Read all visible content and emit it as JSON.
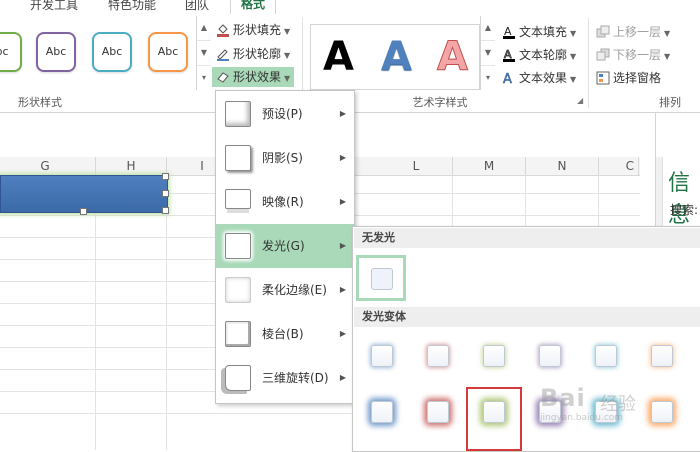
{
  "tabs": [
    {
      "label": "开发工具"
    },
    {
      "label": "特色功能"
    },
    {
      "label": "团队"
    },
    {
      "label": "格式"
    }
  ],
  "ribbon": {
    "shape_styles": {
      "label": "形状样式",
      "swatches": [
        {
          "text": "bc",
          "color": "#70ad47"
        },
        {
          "text": "Abc",
          "color": "#8064a2"
        },
        {
          "text": "Abc",
          "color": "#4bacc6"
        },
        {
          "text": "Abc",
          "color": "#f79646"
        }
      ],
      "commands": [
        {
          "label": "形状填充",
          "icon": "paint-bucket-icon"
        },
        {
          "label": "形状轮廓",
          "icon": "pen-outline-icon"
        },
        {
          "label": "形状效果",
          "icon": "shape-effects-icon"
        }
      ]
    },
    "wordart": {
      "label": "艺术字样式",
      "letters": [
        {
          "text": "A",
          "color": "#000000"
        },
        {
          "text": "A",
          "color": "#4f81bd"
        },
        {
          "text": "A",
          "color": "#e06666"
        }
      ],
      "commands": [
        {
          "label": "文本填充",
          "icon": "text-fill-icon"
        },
        {
          "label": "文本轮廓",
          "icon": "text-outline-icon"
        },
        {
          "label": "文本效果",
          "icon": "text-effects-icon"
        }
      ]
    },
    "arrange": {
      "label": "排列",
      "commands": [
        {
          "label": "上移一层",
          "icon": "bring-forward-icon",
          "enabled": false
        },
        {
          "label": "下移一层",
          "icon": "send-backward-icon",
          "enabled": false
        },
        {
          "label": "选择窗格",
          "icon": "selection-pane-icon",
          "enabled": true
        }
      ]
    }
  },
  "sheet": {
    "columns": [
      "G",
      "H",
      "I",
      "L",
      "M",
      "N",
      "C"
    ]
  },
  "pane": {
    "title": "信息",
    "search_label": "搜索:"
  },
  "menu": {
    "items": [
      {
        "label": "预设(P)"
      },
      {
        "label": "阴影(S)"
      },
      {
        "label": "映像(R)"
      },
      {
        "label": "发光(G)"
      },
      {
        "label": "柔化边缘(E)"
      },
      {
        "label": "棱台(B)"
      },
      {
        "label": "三维旋转(D)"
      }
    ]
  },
  "submenu": {
    "no_glow_header": "无发光",
    "variants_header": "发光变体",
    "glow_colors": [
      "#4f81bd",
      "#c0504d",
      "#9bbb59",
      "#8064a2",
      "#4bacc6",
      "#f79646"
    ]
  },
  "watermark": {
    "brand": "Bai",
    "brand_suffix": "经验",
    "url": "jingyan.baidu.com"
  }
}
